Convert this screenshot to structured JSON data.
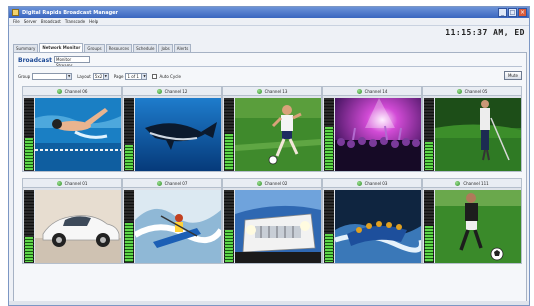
{
  "window": {
    "title": "Digital Rapids Broadcast Manager",
    "controls": {
      "minimize": "_",
      "maximize": "□",
      "close": "×"
    }
  },
  "menu": [
    "File",
    "Server",
    "Broadcast",
    "Transcode",
    "Help"
  ],
  "clock": "11:15:37 AM, ED",
  "tabs": [
    {
      "label": "Summary",
      "active": false
    },
    {
      "label": "Network Monitor",
      "active": true
    },
    {
      "label": "Groups",
      "active": false
    },
    {
      "label": "Resources",
      "active": false
    },
    {
      "label": "Schedule",
      "active": false
    },
    {
      "label": "Jobs",
      "active": false
    },
    {
      "label": "Alerts",
      "active": false
    }
  ],
  "section": {
    "title": "Broadcast",
    "selector_value": "Monitor Streams"
  },
  "controls": {
    "group_label": "Group",
    "group_value": "",
    "layout_label": "Layout",
    "layout_value": "5x2",
    "page_label": "Page",
    "page_value": "1 of 1",
    "autocycle_label": "Auto Cycle",
    "mute_label": "Mute"
  },
  "channels": [
    {
      "label": "Channel 06",
      "scene": "swimmer",
      "status": "ok",
      "audio_level": 0.45
    },
    {
      "label": "Channel 12",
      "scene": "whale",
      "status": "ok",
      "audio_level": 0.35
    },
    {
      "label": "Channel 13",
      "scene": "soccer-kid",
      "status": "ok",
      "audio_level": 0.5
    },
    {
      "label": "Channel 14",
      "scene": "concert",
      "status": "ok",
      "audio_level": 0.6
    },
    {
      "label": "Channel 05",
      "scene": "golf",
      "status": "ok",
      "audio_level": 0.4
    },
    {
      "label": "Channel 01",
      "scene": "sports-car",
      "status": "ok",
      "audio_level": 0.35
    },
    {
      "label": "Channel 07",
      "scene": "kayak",
      "status": "ok",
      "audio_level": 0.55
    },
    {
      "label": "Channel 02",
      "scene": "jeep",
      "status": "ok",
      "audio_level": 0.45
    },
    {
      "label": "Channel 03",
      "scene": "rafting",
      "status": "ok",
      "audio_level": 0.4
    },
    {
      "label": "Channel 111",
      "scene": "soccer-player",
      "status": "ok",
      "audio_level": 0.5
    }
  ]
}
